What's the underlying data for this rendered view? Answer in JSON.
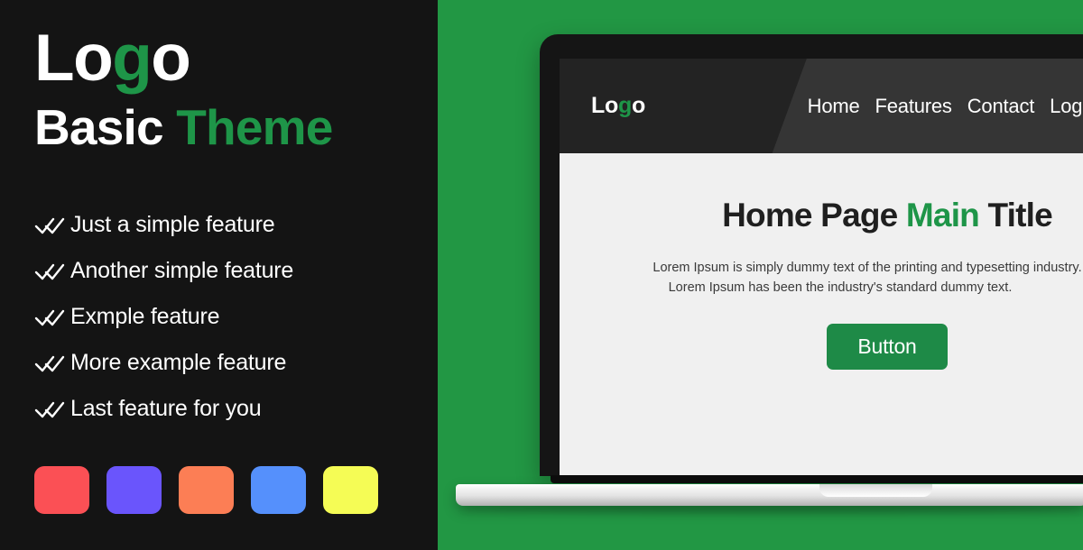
{
  "colors": {
    "panel_dark": "#141414",
    "background_green": "#229744",
    "accent_green": "#1e9548",
    "button_green": "#1e8a47",
    "screen_body": "#f0f0f0",
    "navbar_dark": "#232323",
    "text_white": "#ffffff"
  },
  "left_panel": {
    "logo": {
      "part1": "Lo",
      "accent": "g",
      "part2": "o"
    },
    "tagline": {
      "part1": "Basic ",
      "accent": "Theme"
    },
    "features": [
      {
        "icon": "double-check-icon",
        "label": "Just a simple feature"
      },
      {
        "icon": "double-check-icon",
        "label": "Another simple feature"
      },
      {
        "icon": "double-check-icon",
        "label": "Exmple feature"
      },
      {
        "icon": "double-check-icon",
        "label": "More example feature"
      },
      {
        "icon": "double-check-icon",
        "label": "Last feature for you"
      }
    ],
    "swatches": [
      {
        "name": "swatch-red",
        "color": "#fb5055"
      },
      {
        "name": "swatch-purple",
        "color": "#6a55fc"
      },
      {
        "name": "swatch-orange",
        "color": "#fc7e55"
      },
      {
        "name": "swatch-blue",
        "color": "#5590fc"
      },
      {
        "name": "swatch-yellow",
        "color": "#f5fc55"
      }
    ]
  },
  "laptop": {
    "site": {
      "navbar": {
        "logo": {
          "part1": "Lo",
          "accent": "g",
          "part2": "o"
        },
        "links": [
          {
            "label": "Home"
          },
          {
            "label": "Features"
          },
          {
            "label": "Contact"
          },
          {
            "label": "Login"
          }
        ]
      },
      "hero": {
        "title": {
          "part1": "Home Page ",
          "accent": "Main",
          "part2": " Title"
        },
        "paragraph_line1": "Lorem Ipsum is simply dummy text of the printing and typesetting industry.",
        "paragraph_line2": "Lorem Ipsum has been the industry's standard dummy text.",
        "button_label": "Button"
      }
    }
  }
}
